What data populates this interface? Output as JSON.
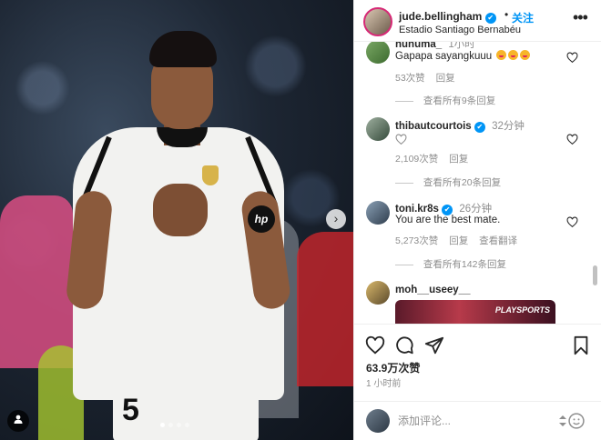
{
  "post": {
    "image_alt_icon": "user-tag-icon",
    "carousel_dots": 4,
    "active_dot": 0
  },
  "header": {
    "username": "jude.bellingham",
    "verified_mark": "✔",
    "separator": "•",
    "follow_label": "关注",
    "location": "Estadio Santiago Bernabéu",
    "more_label": "•••"
  },
  "comments": [
    {
      "name": "nunuma_",
      "time": "1小时",
      "text": "Gapapa sayangkuuu",
      "emoji_count": 3,
      "likes": "53次赞",
      "reply": "回复",
      "view_replies": "查看所有9条回复"
    },
    {
      "name": "thibautcourtois",
      "verified": true,
      "time": "32分钟",
      "text": "",
      "likes": "2,109次赞",
      "reply": "回复",
      "view_replies": "查看所有20条回复"
    },
    {
      "name": "toni.kr8s",
      "verified": true,
      "time": "26分钟",
      "text": "You are the best mate.",
      "likes": "5,273次赞",
      "reply": "回复",
      "translate": "查看翻译",
      "view_replies": "查看所有142条回复"
    },
    {
      "name": "moh__useey__",
      "preview_logo": "PLAYSPORTS"
    }
  ],
  "actions": {
    "likes": "63.9万次赞",
    "posted": "1 小时前"
  },
  "composer": {
    "placeholder": "添加评论..."
  },
  "colors": {
    "accent": "#0095f6",
    "text": "#262626",
    "muted": "#8e8e8e"
  }
}
